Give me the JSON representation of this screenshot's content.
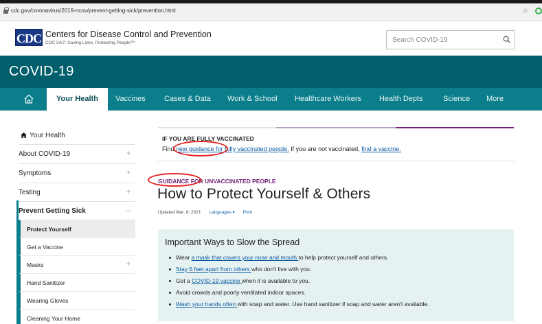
{
  "browser": {
    "url": "cdc.gov/coronavirus/2019-ncov/prevent-getting-sick/prevention.html"
  },
  "header": {
    "logo_text": "CDC",
    "title": "Centers for Disease Control and Prevention",
    "tagline": "CDC 24/7: Saving Lives, Protecting People™",
    "search_placeholder": "Search COVID-19"
  },
  "band": {
    "title": "COVID-19"
  },
  "nav": {
    "items": [
      {
        "label": "Your Health",
        "active": true
      },
      {
        "label": "Vaccines"
      },
      {
        "label": "Cases & Data"
      },
      {
        "label": "Work & School"
      },
      {
        "label": "Healthcare Workers"
      },
      {
        "label": "Health Depts"
      },
      {
        "label": "Science"
      },
      {
        "label": "More"
      }
    ]
  },
  "sidebar": {
    "heading": "Your Health",
    "items": [
      {
        "label": "About COVID-19",
        "toggle": "+"
      },
      {
        "label": "Symptoms",
        "toggle": "+"
      },
      {
        "label": "Testing",
        "toggle": "+"
      },
      {
        "label": "Prevent Getting Sick",
        "toggle": "–"
      }
    ],
    "subitems": [
      {
        "label": "Protect Yourself",
        "selected": true
      },
      {
        "label": "Get a Vaccine"
      },
      {
        "label": "Masks",
        "toggle": "+"
      },
      {
        "label": "Hand Sanitizer"
      },
      {
        "label": "Wearing Gloves"
      },
      {
        "label": "Cleaning Your Home"
      }
    ]
  },
  "main": {
    "vax_heading": "IF YOU ARE FULLY VACCINATED",
    "vax_find": "Find ",
    "vax_link1": "new guidance for fully vaccinated people.",
    "vax_mid": " If you are not vaccinated, ",
    "vax_link2": "find a vaccine.",
    "eyebrow": "GUIDANCE FOR UNVACCINATED PEOPLE",
    "title": "How to Protect Yourself & Others",
    "updated": "Updated Mar. 8, 2021",
    "languages": "Languages ▾",
    "print": "Print",
    "box_title": "Important Ways to Slow the Spread",
    "bullets": [
      {
        "pre": "Wear ",
        "link": "a mask that covers your nose and mouth ",
        "post": "to help protect yourself and others."
      },
      {
        "pre": "",
        "link": "Stay 6 feet apart from others ",
        "post": "who don't live with you."
      },
      {
        "pre": "Get a ",
        "link": "COVID-19 vaccine ",
        "post": "when it is available to you."
      },
      {
        "pre": "Avoid crowds and poorly ventilated indoor spaces.",
        "link": "",
        "post": ""
      },
      {
        "pre": "",
        "link": "Wash your hands often ",
        "post": "with soap and water. Use hand sanitizer if soap and water aren't available."
      }
    ]
  },
  "colors": {
    "band": "#005f6b",
    "nav": "#0b7e8b",
    "eyebrow": "#712177",
    "annotation": "#e32222",
    "callout_bg": "#e6f1f2"
  }
}
